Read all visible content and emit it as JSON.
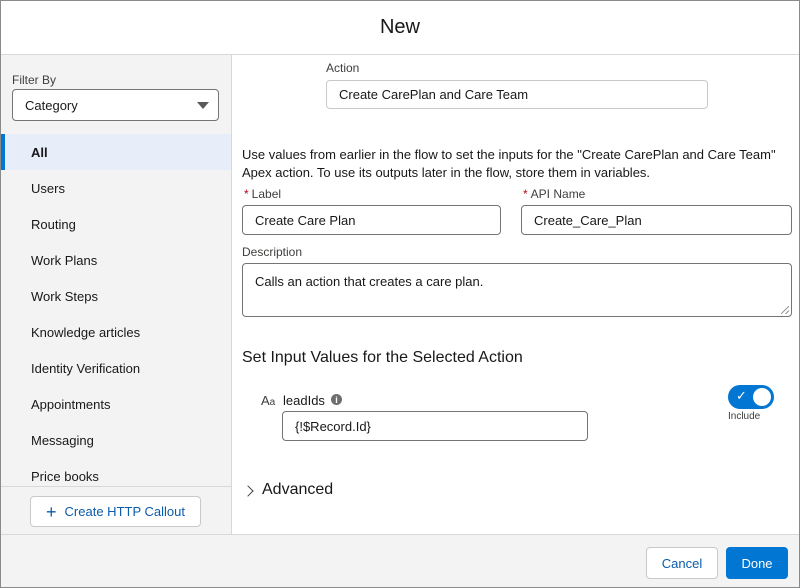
{
  "modal": {
    "title": "New"
  },
  "sidebar": {
    "filter_label": "Filter By",
    "filter_value": "Category",
    "categories": [
      {
        "label": "All",
        "active": true
      },
      {
        "label": "Users"
      },
      {
        "label": "Routing"
      },
      {
        "label": "Work Plans"
      },
      {
        "label": "Work Steps"
      },
      {
        "label": "Knowledge articles"
      },
      {
        "label": "Identity Verification"
      },
      {
        "label": "Appointments"
      },
      {
        "label": "Messaging"
      },
      {
        "label": "Price books"
      }
    ],
    "create_button": "Create HTTP Callout"
  },
  "form": {
    "action_label": "Action",
    "action_value": "Create CarePlan and Care Team",
    "intro": "Use values from earlier in the flow to set the inputs for the \"Create CarePlan and Care Team\" Apex action. To use its outputs later in the flow, store them in variables.",
    "required_marker": "*",
    "label_label": "Label",
    "label_value": "Create Care Plan",
    "api_name_label": "API Name",
    "api_name_value": "Create_Care_Plan",
    "description_label": "Description",
    "description_value": "Calls an action that creates a care plan.",
    "input_section_title": "Set Input Values for the Selected Action",
    "param_type_icon_big": "A",
    "param_type_icon_small": "a",
    "param_info_glyph": "i",
    "param_name": "leadIds",
    "param_value": "{!$Record.Id}",
    "include_label": "Include",
    "include_on": true,
    "toggle_check_glyph": "✓",
    "advanced_label": "Advanced"
  },
  "footer": {
    "cancel": "Cancel",
    "done": "Done"
  },
  "colors": {
    "brand": "#0176d3",
    "link": "#0b5cab",
    "required": "#ba0517"
  }
}
